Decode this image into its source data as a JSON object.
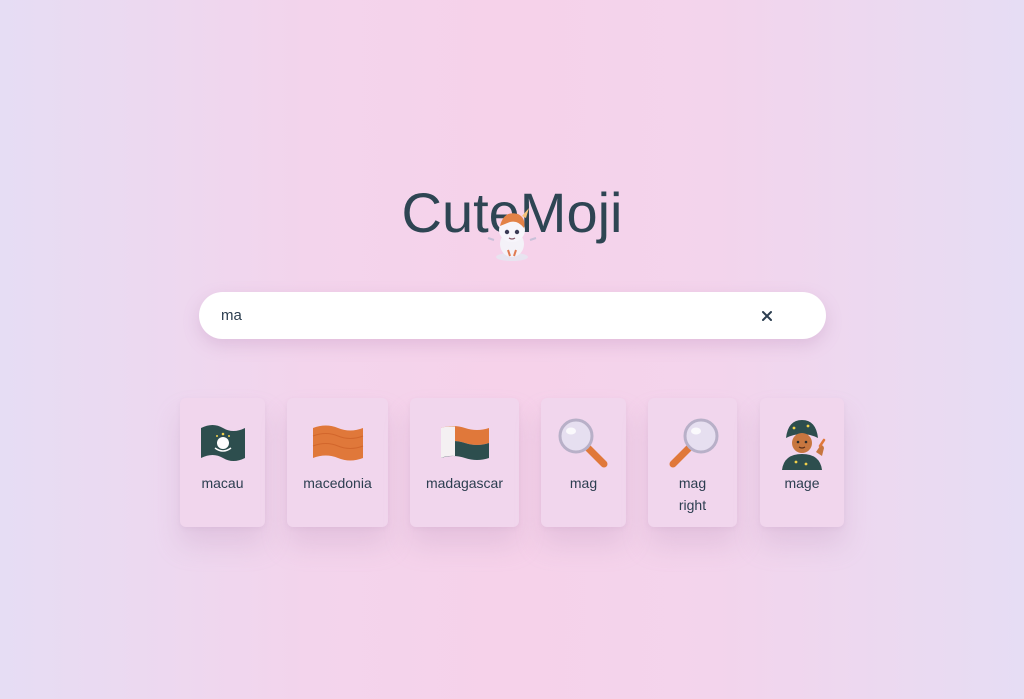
{
  "app": {
    "title": "CuteMoji"
  },
  "search": {
    "value": "ma",
    "clear_label": "×"
  },
  "results": [
    {
      "label": "macau",
      "icon": "flag-macau-icon"
    },
    {
      "label": "macedonia",
      "icon": "flag-macedonia-icon"
    },
    {
      "label": "madagascar",
      "icon": "flag-madagascar-icon"
    },
    {
      "label": "mag",
      "icon": "magnifying-glass-left-icon"
    },
    {
      "label": "mag right",
      "icon": "magnifying-glass-right-icon"
    },
    {
      "label": "mage",
      "icon": "mage-icon"
    }
  ],
  "colors": {
    "title": "#2e4553",
    "card": "#f1d6ed",
    "search_bg": "#ffffff",
    "accent_orange": "#e0783a"
  }
}
